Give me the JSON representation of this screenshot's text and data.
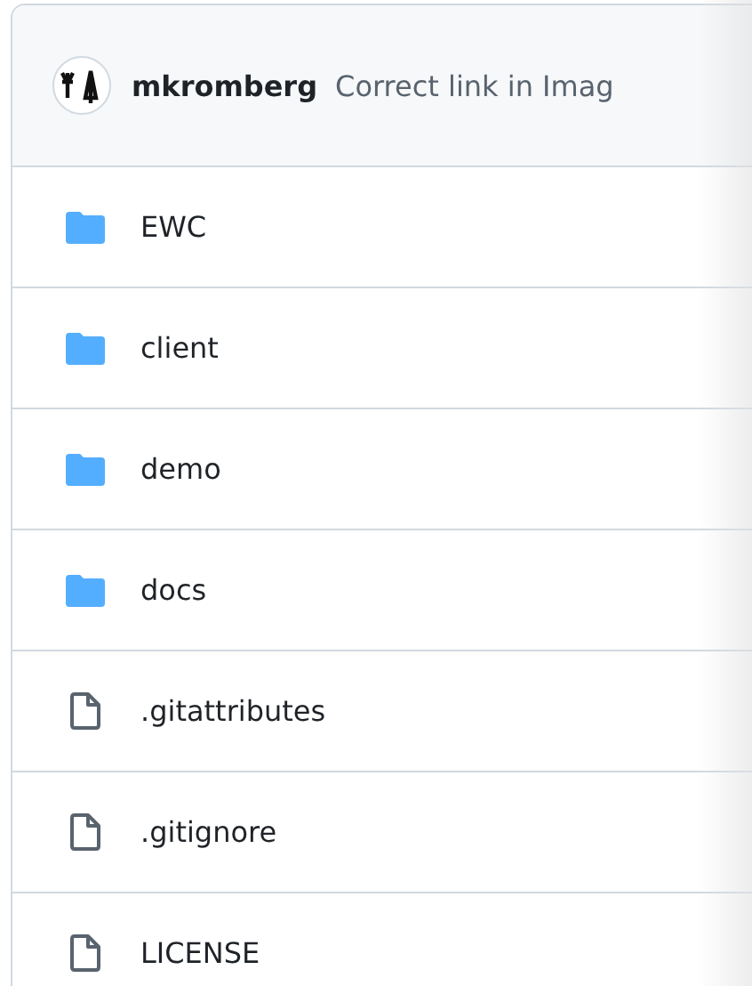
{
  "commit_header": {
    "author": "mkromberg",
    "message": "Correct link in Imag"
  },
  "files": [
    {
      "kind": "folder",
      "name": "EWC"
    },
    {
      "kind": "folder",
      "name": "client"
    },
    {
      "kind": "folder",
      "name": "demo"
    },
    {
      "kind": "folder",
      "name": "docs"
    },
    {
      "kind": "file",
      "name": ".gitattributes"
    },
    {
      "kind": "file",
      "name": ".gitignore"
    },
    {
      "kind": "file",
      "name": "LICENSE"
    }
  ]
}
